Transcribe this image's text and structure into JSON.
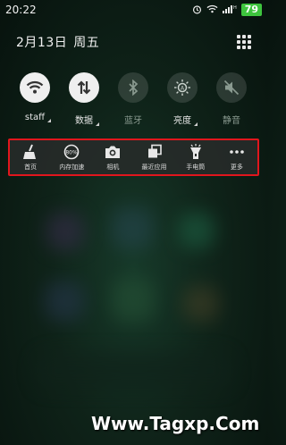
{
  "status_bar": {
    "time": "20:22",
    "icons": [
      "alarm-icon",
      "wifi-icon",
      "signal-icon"
    ],
    "battery": "79"
  },
  "header": {
    "date": "2月13日",
    "weekday": "周五"
  },
  "toggles": [
    {
      "label": "staff",
      "icon": "wifi-icon",
      "state": "on",
      "has_more": true
    },
    {
      "label": "数据",
      "icon": "data-arrows-icon",
      "state": "on",
      "has_more": true
    },
    {
      "label": "蓝牙",
      "icon": "bluetooth-icon",
      "state": "off",
      "has_more": false
    },
    {
      "label": "亮度",
      "icon": "brightness-icon",
      "state": "off",
      "has_more": true
    },
    {
      "label": "静音",
      "icon": "mute-icon",
      "state": "off",
      "has_more": false
    }
  ],
  "shortcuts": [
    {
      "label": "首页",
      "icon": "broom-icon"
    },
    {
      "label": "内存加速",
      "icon": "memory-accelerate-icon",
      "icon_text": "80%"
    },
    {
      "label": "相机",
      "icon": "camera-icon"
    },
    {
      "label": "最近应用",
      "icon": "recent-apps-icon"
    },
    {
      "label": "手电筒",
      "icon": "flashlight-icon"
    },
    {
      "label": "更多",
      "icon": "more-icon"
    }
  ],
  "colors": {
    "highlight_border": "#e1161d",
    "battery": "#3ec43e"
  },
  "watermark": "Www.Tagxp.Com"
}
